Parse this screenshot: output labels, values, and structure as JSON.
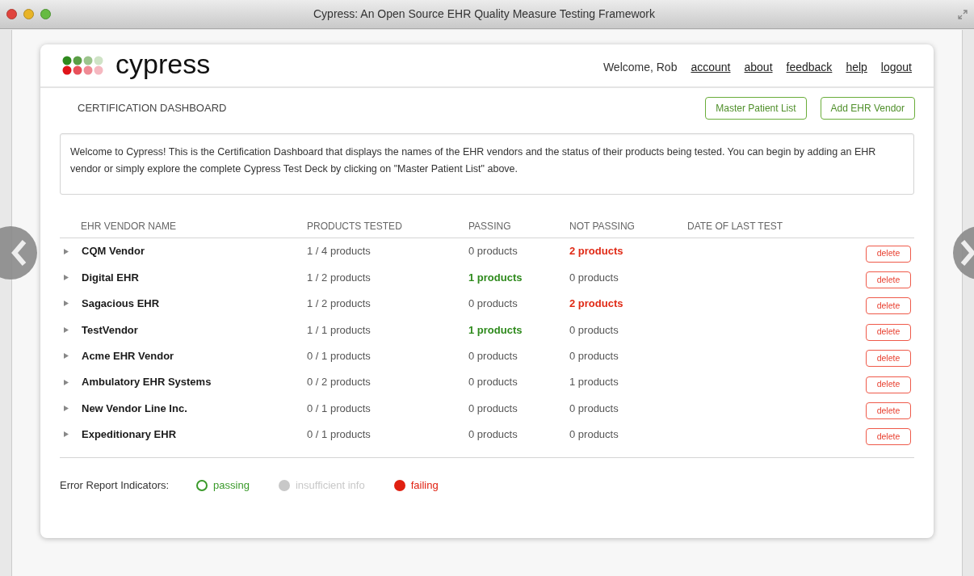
{
  "window": {
    "title": "Cypress: An Open Source EHR Quality Measure Testing Framework"
  },
  "header": {
    "logo_text": "cypress",
    "welcome": "Welcome, Rob",
    "links": [
      "account",
      "about",
      "feedback",
      "help",
      "logout"
    ]
  },
  "page": {
    "title": "CERTIFICATION DASHBOARD",
    "buttons": [
      "Master Patient List",
      "Add EHR Vendor"
    ],
    "intro": "Welcome to Cypress! This is the Certification Dashboard that displays the names of the EHR vendors and the status of their products being tested. You can begin by adding an EHR vendor or simply explore the complete Cypress Test Deck by clicking on \"Master Patient List\" above."
  },
  "table": {
    "columns": [
      "EHR VENDOR NAME",
      "PRODUCTS TESTED",
      "PASSING",
      "NOT PASSING",
      "DATE OF LAST TEST"
    ],
    "rows": [
      {
        "name": "CQM Vendor",
        "tested": "1 / 4 products",
        "passing": {
          "text": "0 products",
          "emphasis": false
        },
        "not_passing": {
          "text": "2 products",
          "emphasis": true
        },
        "action": "delete"
      },
      {
        "name": "Digital EHR",
        "tested": "1 / 2 products",
        "passing": {
          "text": "1 products",
          "emphasis": true
        },
        "not_passing": {
          "text": "0 products",
          "emphasis": false
        },
        "action": "delete"
      },
      {
        "name": "Sagacious EHR",
        "tested": "1 / 2 products",
        "passing": {
          "text": "0 products",
          "emphasis": false
        },
        "not_passing": {
          "text": "2 products",
          "emphasis": true
        },
        "action": "delete"
      },
      {
        "name": "TestVendor",
        "tested": "1 / 1 products",
        "passing": {
          "text": "1 products",
          "emphasis": true
        },
        "not_passing": {
          "text": "0 products",
          "emphasis": false
        },
        "action": "delete"
      },
      {
        "name": "Acme EHR Vendor",
        "tested": "0 / 1 products",
        "passing": {
          "text": "0 products",
          "emphasis": false
        },
        "not_passing": {
          "text": "0 products",
          "emphasis": false
        },
        "action": "delete"
      },
      {
        "name": "Ambulatory EHR Systems",
        "tested": "0 / 2 products",
        "passing": {
          "text": "0 products",
          "emphasis": false
        },
        "not_passing": {
          "text": "1 products",
          "emphasis": false
        },
        "action": "delete"
      },
      {
        "name": "New Vendor Line Inc.",
        "tested": "0 / 1 products",
        "passing": {
          "text": "0 products",
          "emphasis": false
        },
        "not_passing": {
          "text": "0 products",
          "emphasis": false
        },
        "action": "delete"
      },
      {
        "name": "Expeditionary EHR",
        "tested": "0 / 1 products",
        "passing": {
          "text": "0 products",
          "emphasis": false
        },
        "not_passing": {
          "text": "0 products",
          "emphasis": false
        },
        "action": "delete"
      }
    ]
  },
  "legend": {
    "label": "Error Report Indicators:",
    "items": [
      {
        "kind": "ring",
        "color": "#3a9a2a",
        "label": "passing"
      },
      {
        "kind": "dot",
        "color": "#c8c8c8",
        "label": "insufficient info"
      },
      {
        "kind": "dot",
        "color": "#e02010",
        "label": "failing"
      }
    ]
  }
}
